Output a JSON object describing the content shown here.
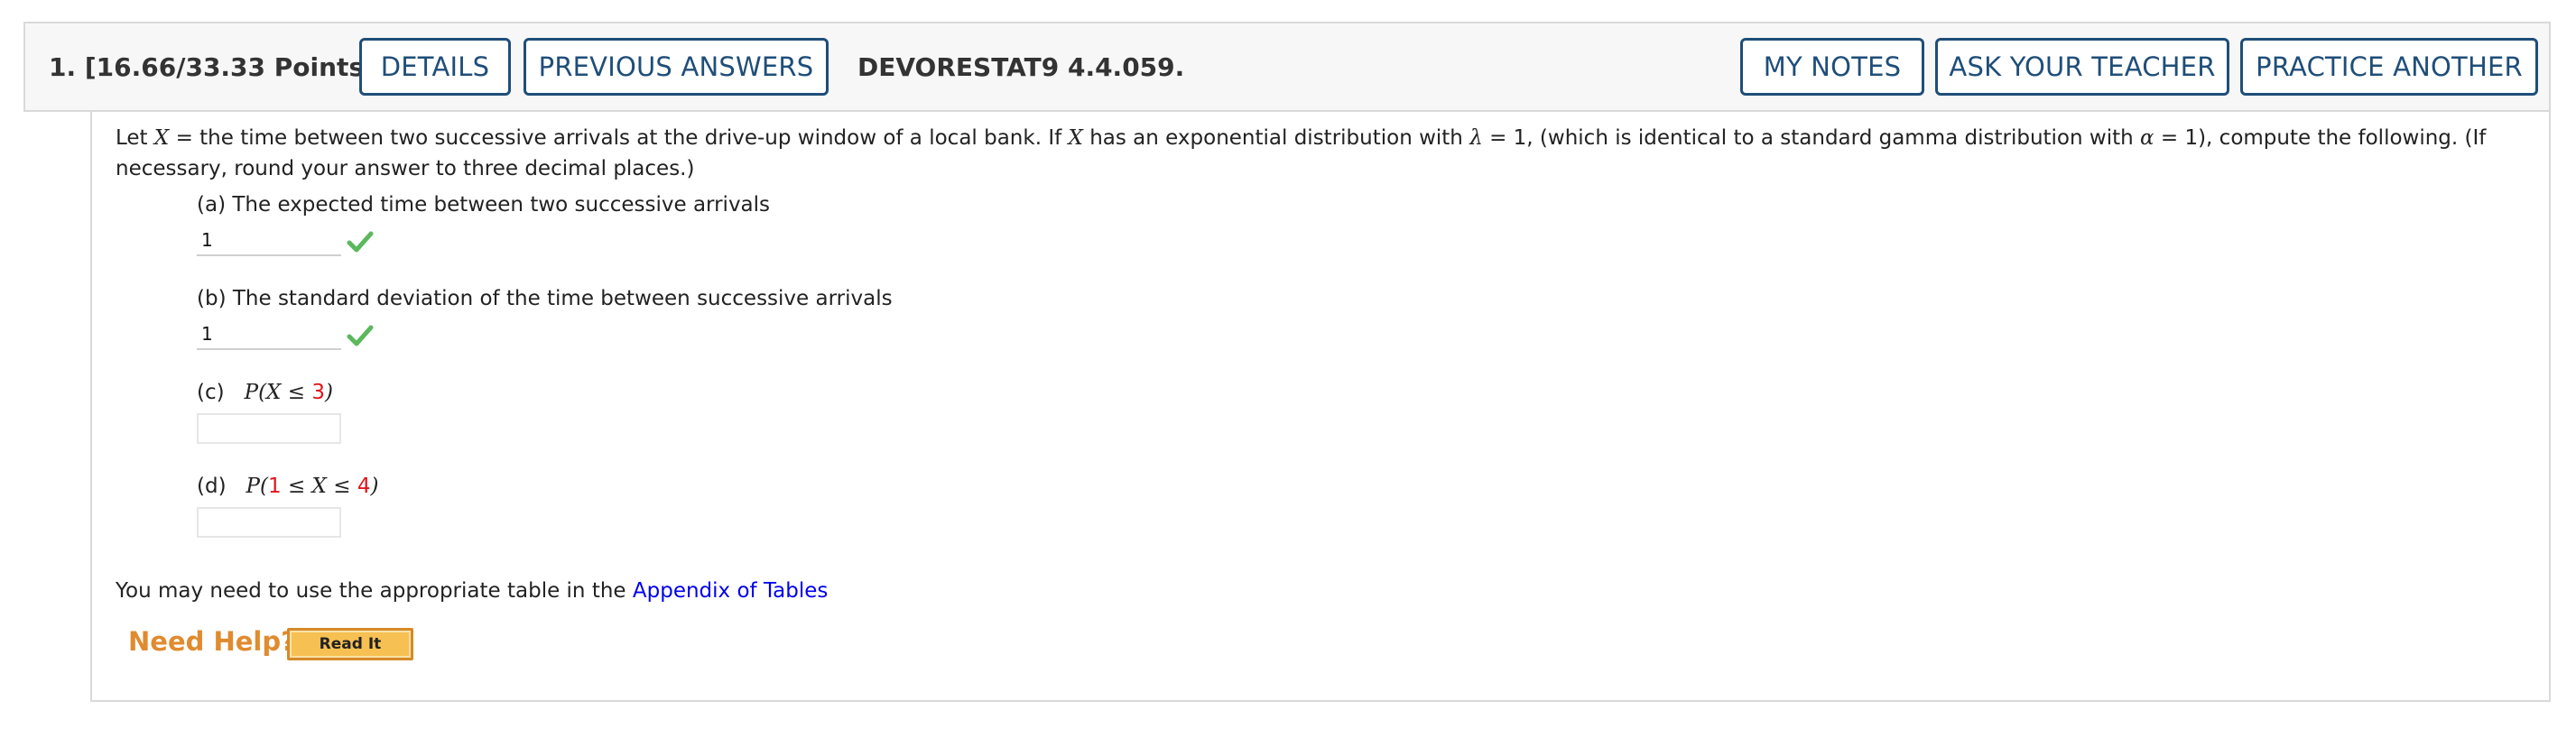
{
  "header": {
    "question_points": "1.  [16.66/33.33 Points]",
    "details_label": "DETAILS",
    "previous_answers_label": "PREVIOUS ANSWERS",
    "question_code": "DEVORESTAT9 4.4.059.",
    "my_notes_label": "MY NOTES",
    "ask_teacher_label": "ASK YOUR TEACHER",
    "practice_another_label": "PRACTICE ANOTHER",
    "button_border_color": "#1f4e79"
  },
  "problem": {
    "intro": {
      "t1": "Let ",
      "var_x": "X",
      "t2": " = the time between two successive arrivals at the drive-up window of a local bank. If ",
      "var_x2": "X",
      "t3": " has an exponential distribution with ",
      "lambda": "λ",
      "t4": " = 1, (which is identical to a standard gamma distribution with ",
      "alpha": "α",
      "t5": " = 1), compute the following. (If necessary, round your answer to three decimal places.)"
    },
    "parts": {
      "a": {
        "label": "(a) The expected time between two successive arrivals",
        "value": "1",
        "status": "correct"
      },
      "b": {
        "label": "(b) The standard deviation of the time between successive arrivals",
        "value": "1",
        "status": "correct"
      },
      "c": {
        "prefix": "(c)",
        "m1": "P(X ≤ ",
        "n1": "3",
        "m2": ")",
        "value": ""
      },
      "d": {
        "prefix": "(d)",
        "m1": "P(",
        "n1": "1",
        "m2": " ≤ X ≤ ",
        "n2": "4",
        "m3": ")",
        "value": ""
      }
    },
    "table_note": "You may need to use the appropriate table in the ",
    "table_link": "Appendix of Tables"
  },
  "help": {
    "need_help": "Need Help?",
    "read_it": "Read It"
  },
  "colors": {
    "check_green": "#5cb85c",
    "highlight_red": "#e0151b",
    "help_orange": "#e08b2f"
  }
}
